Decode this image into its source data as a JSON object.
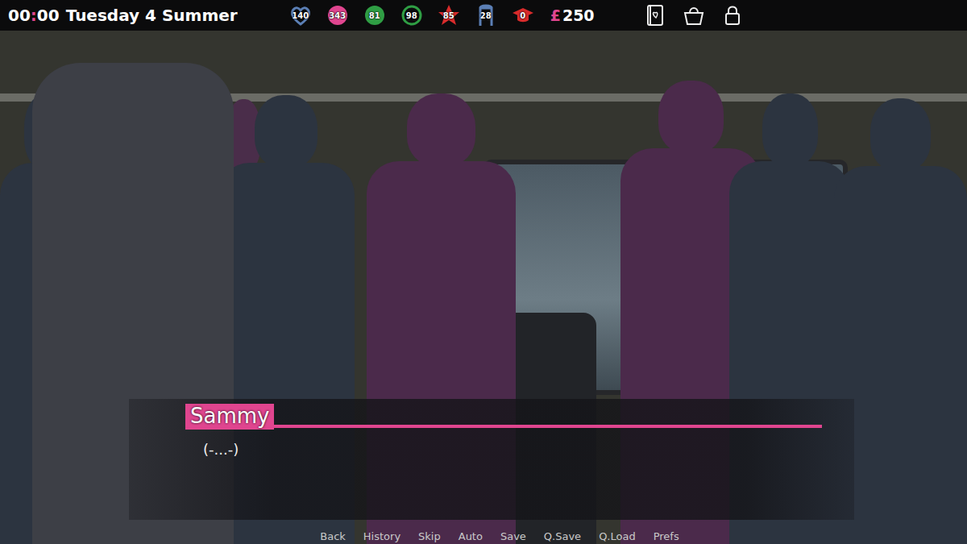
{
  "clock": {
    "hours": "00",
    "separator": ":",
    "minutes": "00",
    "day": "Tuesday 4 Summer"
  },
  "stats": [
    {
      "kind": "heart",
      "value": "140",
      "color": "#5b7fb5"
    },
    {
      "kind": "drop",
      "value": "343",
      "color": "#e0458f"
    },
    {
      "kind": "sleep",
      "value": "81",
      "color": "#2f9e44"
    },
    {
      "kind": "ring",
      "value": "98",
      "color": "#2f9e44"
    },
    {
      "kind": "star",
      "value": "85",
      "color": "#d92b2b"
    },
    {
      "kind": "person",
      "value": "28",
      "color": "#5b7fb5"
    },
    {
      "kind": "cap",
      "value": "0",
      "color": "#d92b2b"
    }
  ],
  "money": {
    "symbol": "£",
    "value": "250"
  },
  "dialogue": {
    "speaker": "Sammy",
    "line": "(-...-)"
  },
  "quick_menu": [
    "Back",
    "History",
    "Skip",
    "Auto",
    "Save",
    "Q.Save",
    "Q.Load",
    "Prefs"
  ]
}
